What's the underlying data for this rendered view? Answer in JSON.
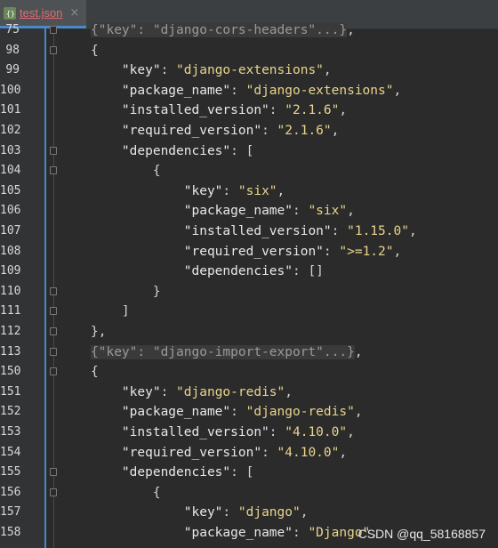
{
  "tab": {
    "label": "test.json",
    "close_glyph": "×"
  },
  "lines": [
    {
      "num": "75",
      "code": "{\"key\": \"django-cors-headers\"...},",
      "collapsed": true
    },
    {
      "num": "98",
      "code": "{"
    },
    {
      "num": "99",
      "code": "    \"key\": \"django-extensions\","
    },
    {
      "num": "100",
      "code": "    \"package_name\": \"django-extensions\","
    },
    {
      "num": "101",
      "code": "    \"installed_version\": \"2.1.6\","
    },
    {
      "num": "102",
      "code": "    \"required_version\": \"2.1.6\","
    },
    {
      "num": "103",
      "code": "    \"dependencies\": ["
    },
    {
      "num": "104",
      "code": "        {"
    },
    {
      "num": "105",
      "code": "            \"key\": \"six\","
    },
    {
      "num": "106",
      "code": "            \"package_name\": \"six\","
    },
    {
      "num": "107",
      "code": "            \"installed_version\": \"1.15.0\","
    },
    {
      "num": "108",
      "code": "            \"required_version\": \">=1.2\","
    },
    {
      "num": "109",
      "code": "            \"dependencies\": []"
    },
    {
      "num": "110",
      "code": "        }"
    },
    {
      "num": "111",
      "code": "    ]"
    },
    {
      "num": "112",
      "code": "},"
    },
    {
      "num": "113",
      "code": "{\"key\": \"django-import-export\"...},",
      "collapsed": true
    },
    {
      "num": "150",
      "code": "{"
    },
    {
      "num": "151",
      "code": "    \"key\": \"django-redis\","
    },
    {
      "num": "152",
      "code": "    \"package_name\": \"django-redis\","
    },
    {
      "num": "153",
      "code": "    \"installed_version\": \"4.10.0\","
    },
    {
      "num": "154",
      "code": "    \"required_version\": \"4.10.0\","
    },
    {
      "num": "155",
      "code": "    \"dependencies\": ["
    },
    {
      "num": "156",
      "code": "        {"
    },
    {
      "num": "157",
      "code": "            \"key\": \"django\","
    },
    {
      "num": "158",
      "code": "            \"package_name\": \"Django\","
    }
  ],
  "fold_markers": [
    "75",
    "98",
    "103",
    "104",
    "110",
    "111",
    "112",
    "113",
    "150",
    "155",
    "156"
  ],
  "watermark": "CSDN @qq_58168857",
  "colors": {
    "key": "#e8e8e8",
    "string": "#e8d58c",
    "background": "#2b2b2b",
    "gutter_accent": "#4a88c7"
  }
}
